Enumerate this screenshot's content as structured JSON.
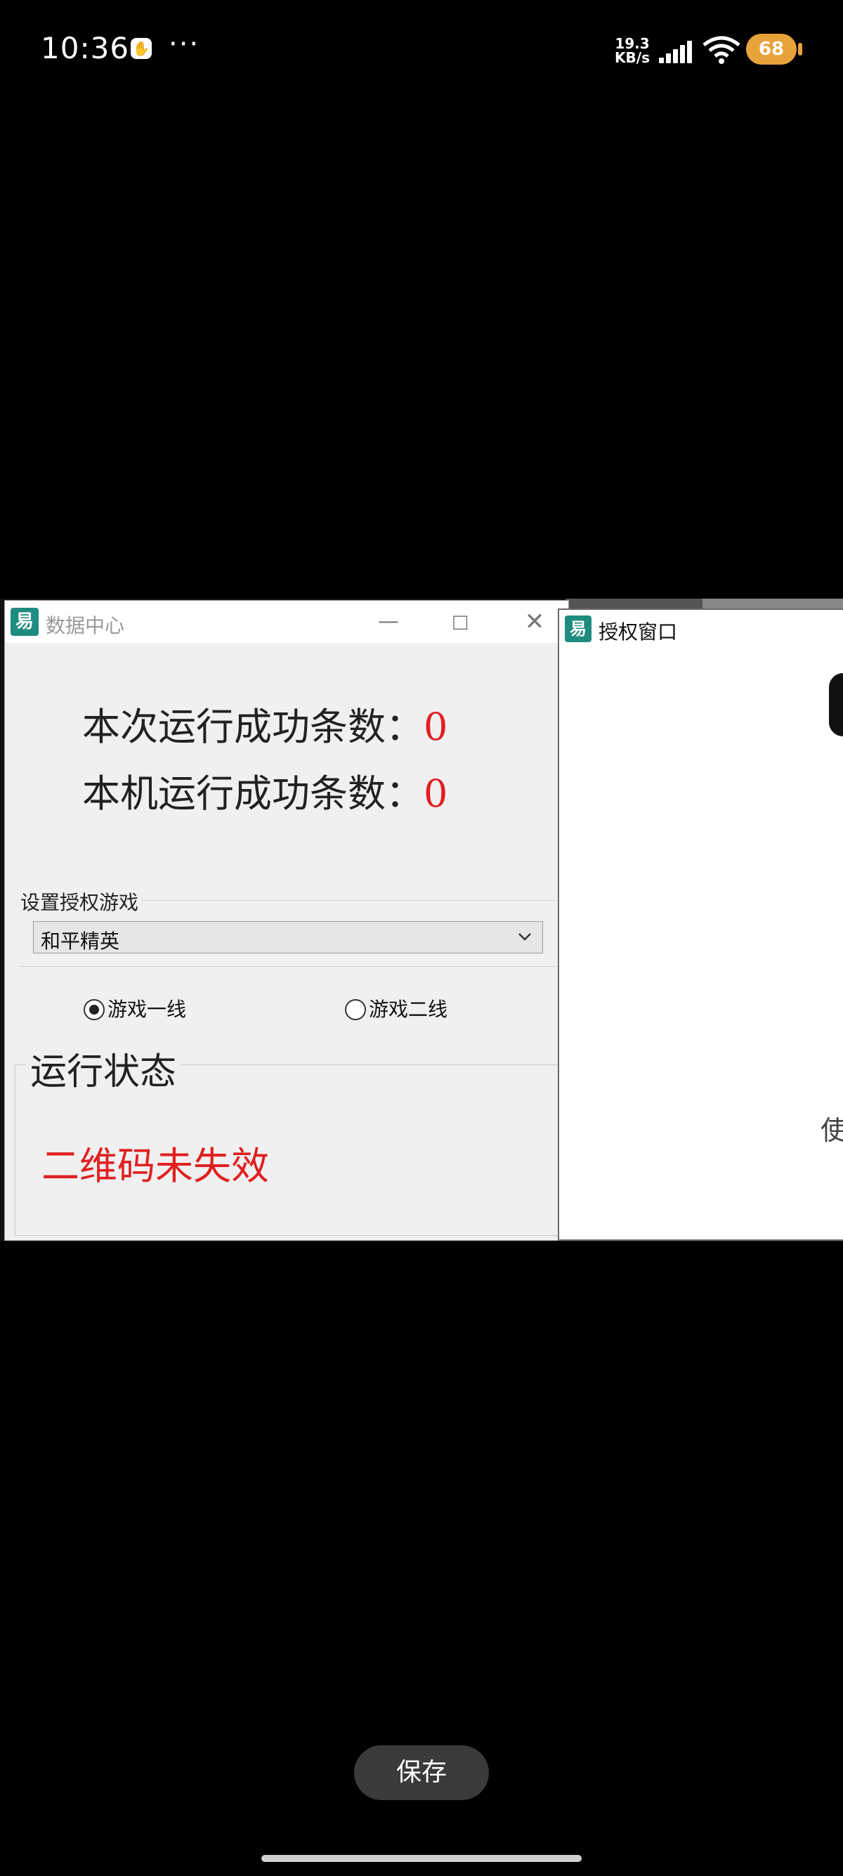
{
  "status_bar": {
    "time": "10:36",
    "more": "···",
    "net_speed_value": "19.3",
    "net_speed_unit": "KB/s",
    "battery": "68"
  },
  "main_window": {
    "title": "数据中心",
    "minimize": "—",
    "maximize": "□",
    "close": "✕",
    "stat_run_label": "本次运行成功条数：",
    "stat_run_value": "0",
    "stat_machine_label": "本机运行成功条数：",
    "stat_machine_value": "0",
    "group_label": "设置授权游戏",
    "game_select_value": "和平精英",
    "radio_line1": "游戏一线",
    "radio_line2": "游戏二线",
    "status_heading": "运行状态",
    "status_message": "二维码未失效"
  },
  "auth_window": {
    "title": "授权窗口",
    "partial_text": "使"
  },
  "bottom": {
    "save_label": "保存"
  },
  "colors": {
    "status_red": "#e02020",
    "logo_teal": "#1e8c7e",
    "battery": "#e8a23a"
  }
}
